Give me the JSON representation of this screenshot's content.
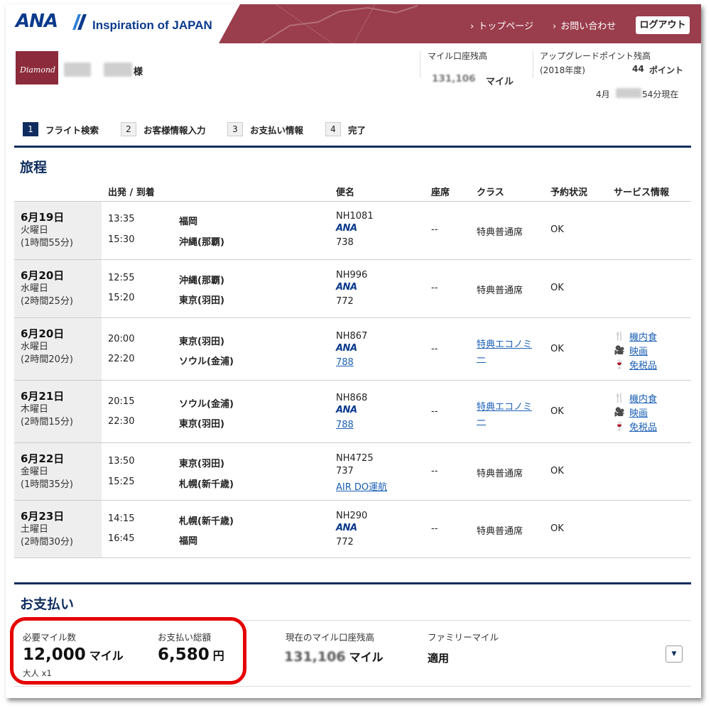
{
  "header": {
    "brand": "ANA",
    "tagline": "Inspiration of JAPAN",
    "nav": [
      "トップページ",
      "お問い合わせ"
    ],
    "logout": "ログアウト"
  },
  "member": {
    "status_badge": "Diamond",
    "suffix": "様",
    "miles_label": "マイル口座残高",
    "miles_value": "131,106",
    "miles_unit": "マイル",
    "upgrade_label": "アップグレードポイント残高",
    "upgrade_year": "(2018年度)",
    "upgrade_value": "44",
    "upgrade_unit": "ポイント",
    "asof_prefix": "4月",
    "asof_suffix": "54分現在"
  },
  "steps": [
    {
      "num": "1",
      "label": "フライト検索",
      "active": true
    },
    {
      "num": "2",
      "label": "お客様情報入力",
      "active": false
    },
    {
      "num": "3",
      "label": "お支払い情報",
      "active": false
    },
    {
      "num": "4",
      "label": "完了",
      "active": false
    }
  ],
  "itinerary": {
    "title": "旅程",
    "headers": [
      "出発 / 到着",
      "便名",
      "座席",
      "クラス",
      "予約状況",
      "サービス情報"
    ],
    "flights": [
      {
        "date": "6月19日",
        "weekday": "火曜日",
        "duration": "(1時間55分)",
        "dep_time": "13:35",
        "dep": "福岡",
        "arr_time": "15:30",
        "arr": "沖縄(那覇)",
        "flight": "NH1081",
        "carrier": "ANA",
        "aircraft": "738",
        "seat": "--",
        "class": "特典普通席",
        "status": "OK"
      },
      {
        "date": "6月20日",
        "weekday": "水曜日",
        "duration": "(2時間25分)",
        "dep_time": "12:55",
        "dep": "沖縄(那覇)",
        "arr_time": "15:20",
        "arr": "東京(羽田)",
        "flight": "NH996",
        "carrier": "ANA",
        "aircraft": "772",
        "seat": "--",
        "class": "特典普通席",
        "status": "OK"
      },
      {
        "date": "6月20日",
        "weekday": "水曜日",
        "duration": "(2時間20分)",
        "dep_time": "20:00",
        "dep": "東京(羽田)",
        "arr_time": "22:20",
        "arr": "ソウル(金浦)",
        "flight": "NH867",
        "carrier": "ANA",
        "aircraft": "788",
        "seat": "--",
        "class_line1": "特典エコノミ",
        "class_line2": "ー",
        "status": "OK",
        "services": [
          "機内食",
          "映画",
          "免税品"
        ]
      },
      {
        "date": "6月21日",
        "weekday": "木曜日",
        "duration": "(2時間15分)",
        "dep_time": "20:15",
        "dep": "ソウル(金浦)",
        "arr_time": "22:30",
        "arr": "東京(羽田)",
        "flight": "NH868",
        "carrier": "ANA",
        "aircraft": "788",
        "seat": "--",
        "class_line1": "特典エコノミ",
        "class_line2": "ー",
        "status": "OK",
        "services": [
          "機内食",
          "映画",
          "免税品"
        ]
      },
      {
        "date": "6月22日",
        "weekday": "金曜日",
        "duration": "(1時間35分)",
        "dep_time": "13:50",
        "dep": "東京(羽田)",
        "arr_time": "15:25",
        "arr": "札幌(新千歳)",
        "flight": "NH4725",
        "aircraft": "737",
        "operator": "AIR DO運航",
        "seat": "--",
        "class": "特典普通席",
        "status": "OK"
      },
      {
        "date": "6月23日",
        "weekday": "土曜日",
        "duration": "(2時間30分)",
        "dep_time": "14:15",
        "dep": "札幌(新千歳)",
        "arr_time": "16:45",
        "arr": "福岡",
        "flight": "NH290",
        "carrier": "ANA",
        "aircraft": "772",
        "seat": "--",
        "class": "特典普通席",
        "status": "OK"
      }
    ]
  },
  "payment": {
    "title": "お支払い",
    "required_miles_label": "必要マイル数",
    "required_miles": "12,000",
    "miles_unit": "マイル",
    "pax": "大人 x1",
    "total_label": "お支払い総額",
    "total": "6,580",
    "yen": "円",
    "current_label": "現在のマイル口座残高",
    "current_value": "131,106",
    "family_label": "ファミリーマイル",
    "family_value": "適用"
  },
  "icons": {
    "meal": "fork-knife-icon",
    "movie": "projector-icon",
    "dutyfree": "bottle-icon"
  },
  "colors": {
    "header": "#9a3d4c",
    "navy": "#0e2c5e",
    "link": "#1a5fb4",
    "highlight": "#e60000"
  }
}
